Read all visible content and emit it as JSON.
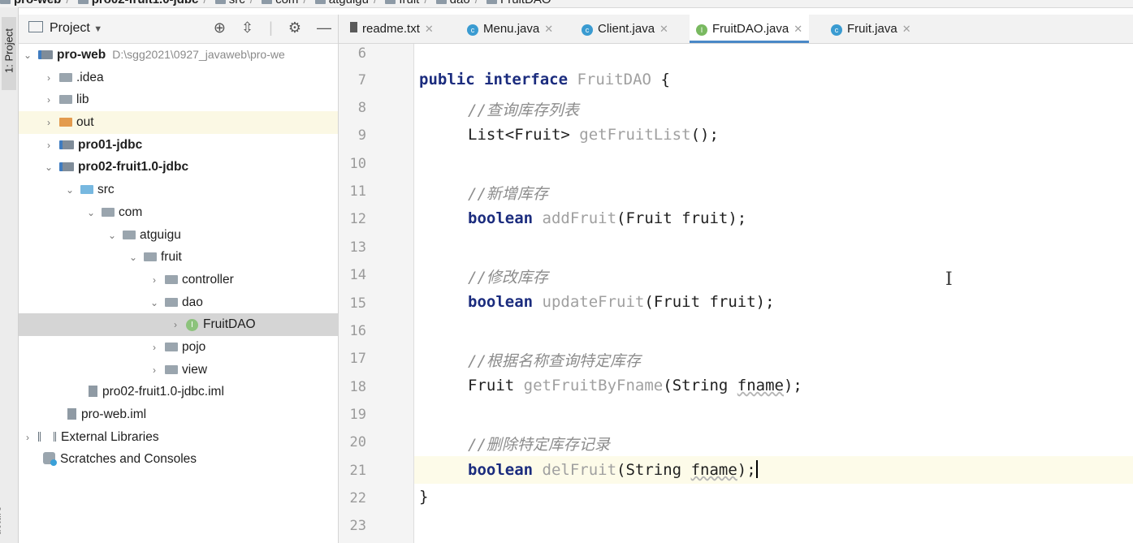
{
  "breadcrumb": [
    "pro-web",
    "pro02-fruit1.0-jdbc",
    "src",
    "com",
    "atguigu",
    "fruit",
    "dao",
    "FruitDAO"
  ],
  "strip": {
    "project_tab": "1: Project",
    "structure_tab": "ucture"
  },
  "project_panel": {
    "title": "Project",
    "tree": [
      {
        "label": "pro-web",
        "path": "D:\\sgg2021\\0927_javaweb\\pro-we",
        "bold": true
      },
      {
        "label": ".idea"
      },
      {
        "label": "lib"
      },
      {
        "label": "out"
      },
      {
        "label": "pro01-jdbc",
        "bold": true
      },
      {
        "label": "pro02-fruit1.0-jdbc",
        "bold": true
      },
      {
        "label": "src"
      },
      {
        "label": "com"
      },
      {
        "label": "atguigu"
      },
      {
        "label": "fruit"
      },
      {
        "label": "controller"
      },
      {
        "label": "dao"
      },
      {
        "label": "FruitDAO",
        "icon_letter": "I"
      },
      {
        "label": "pojo"
      },
      {
        "label": "view"
      },
      {
        "label": "pro02-fruit1.0-jdbc.iml"
      },
      {
        "label": "pro-web.iml"
      },
      {
        "label": "External Libraries"
      },
      {
        "label": "Scratches and Consoles"
      }
    ]
  },
  "tabs": [
    {
      "label": "readme.txt"
    },
    {
      "label": "Menu.java",
      "icon_letter": "c"
    },
    {
      "label": "Client.java",
      "icon_letter": "c"
    },
    {
      "label": "FruitDAO.java",
      "icon_letter": "I",
      "active": true
    },
    {
      "label": "Fruit.java",
      "icon_letter": "c"
    }
  ],
  "editor": {
    "line_numbers": [
      "6",
      "7",
      "8",
      "9",
      "10",
      "11",
      "12",
      "13",
      "14",
      "15",
      "16",
      "17",
      "18",
      "19",
      "20",
      "21",
      "22",
      "23"
    ],
    "code": {
      "l7_kw": "public interface",
      "l7_name": "FruitDAO",
      "l7_brace": " {",
      "l8": "//查询库存列表",
      "l9_type": "List<Fruit>",
      "l9_method": "getFruitList",
      "l9_rest": "();",
      "l11": "//新增库存",
      "l12_kw": "boolean",
      "l12_method": "addFruit",
      "l12_rest_a": "(Fruit ",
      "l12_param": "fruit",
      "l12_rest_b": ");",
      "l14": "//修改库存",
      "l15_kw": "boolean",
      "l15_method": "updateFruit",
      "l15_rest_a": "(Fruit ",
      "l15_param": "fruit",
      "l15_rest_b": ");",
      "l17": "//根据名称查询特定库存",
      "l18_type": "Fruit",
      "l18_method": "getFruitByFname",
      "l18_rest_a": "(String ",
      "l18_param": "fname",
      "l18_rest_b": ");",
      "l20": "//删除特定库存记录",
      "l21_kw": "boolean",
      "l21_method": "delFruit",
      "l21_rest_a": "(String ",
      "l21_param": "fname",
      "l21_rest_b": ");",
      "l22": "}"
    }
  },
  "colors": {
    "keyword": "#1b2c7e",
    "comment": "#8c8c8c",
    "selection": "#d5d5d5",
    "active_tab": "#4a88c7"
  }
}
